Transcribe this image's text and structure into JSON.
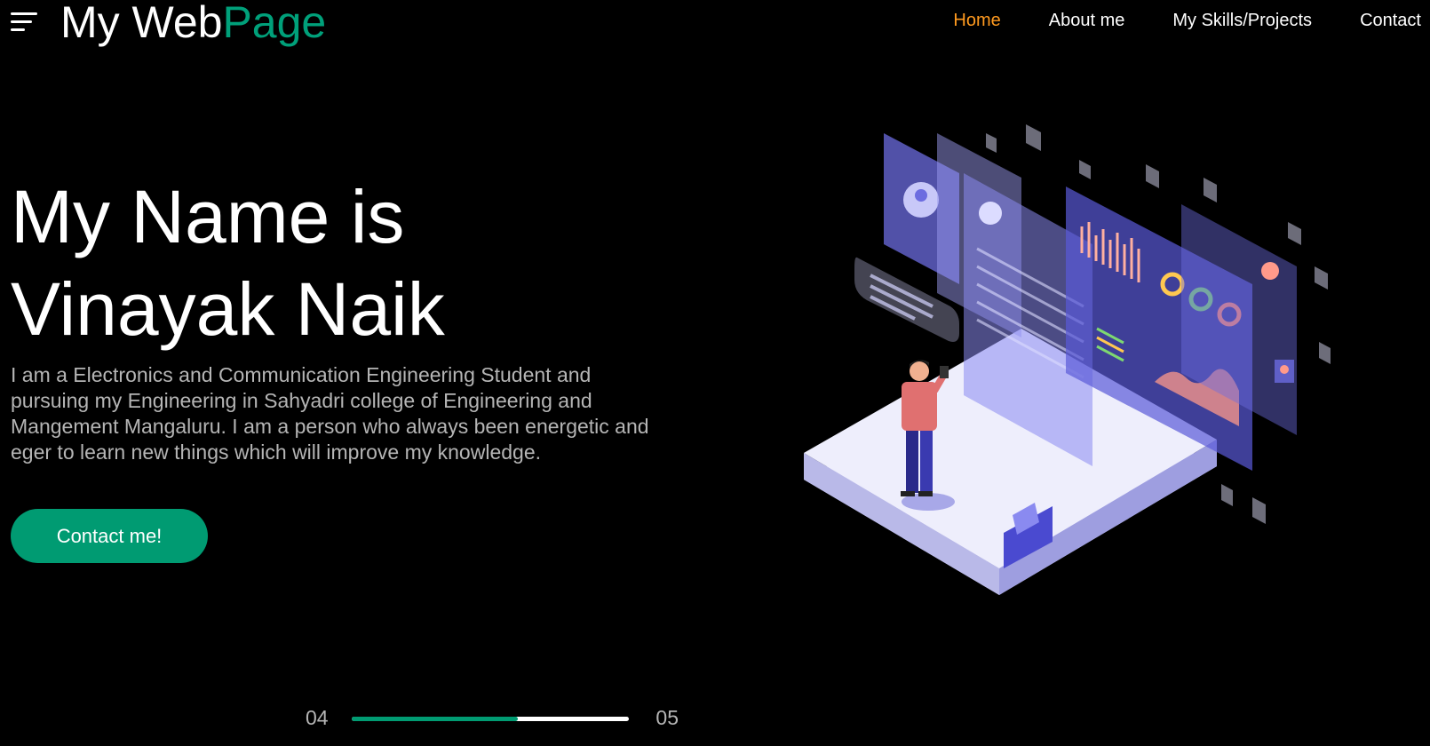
{
  "header": {
    "brand_part1": "My Web",
    "brand_part2": "Page",
    "nav": [
      {
        "label": "Home",
        "active": true
      },
      {
        "label": "About me",
        "active": false
      },
      {
        "label": "My Skills/Projects",
        "active": false
      },
      {
        "label": "Contact",
        "active": false
      }
    ]
  },
  "hero": {
    "title_line1": "My Name is",
    "title_line2": "Vinayak Naik",
    "description": "I am a Electronics and Communication Engineering Student and pursuing my Engineering in Sahyadri college of Engineering and Mangement Mangaluru. I am a person who always been energetic and eger to learn new things which will improve my knowledge.",
    "cta_label": "Contact me!"
  },
  "slider": {
    "current": "04",
    "next": "05",
    "progress": 0.6
  },
  "colors": {
    "background": "#000000",
    "accent_green": "#009b72",
    "active_nav": "#ff9a1f",
    "text_muted": "#b5b5b5"
  },
  "icons": {
    "menu": "menu-icon"
  }
}
